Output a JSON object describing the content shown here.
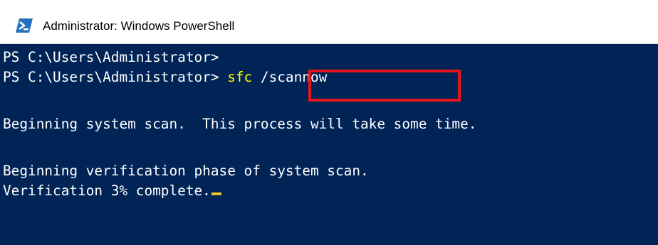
{
  "window": {
    "title": "Administrator: Windows PowerShell",
    "icon": "powershell-icon"
  },
  "console": {
    "prompt_1": "PS C:\\Users\\Administrator>",
    "prompt_2": "PS C:\\Users\\Administrator> ",
    "command_name": "sfc",
    "command_args": " /scannow",
    "output_1": "Beginning system scan.  This process will take some time.",
    "output_2": "Beginning verification phase of system scan.",
    "output_3": "Verification 3% complete."
  },
  "colors": {
    "background": "#012456",
    "text": "#ffffff",
    "command": "#ffff00",
    "highlight": "#e8141c",
    "cursor": "#eec42d"
  }
}
